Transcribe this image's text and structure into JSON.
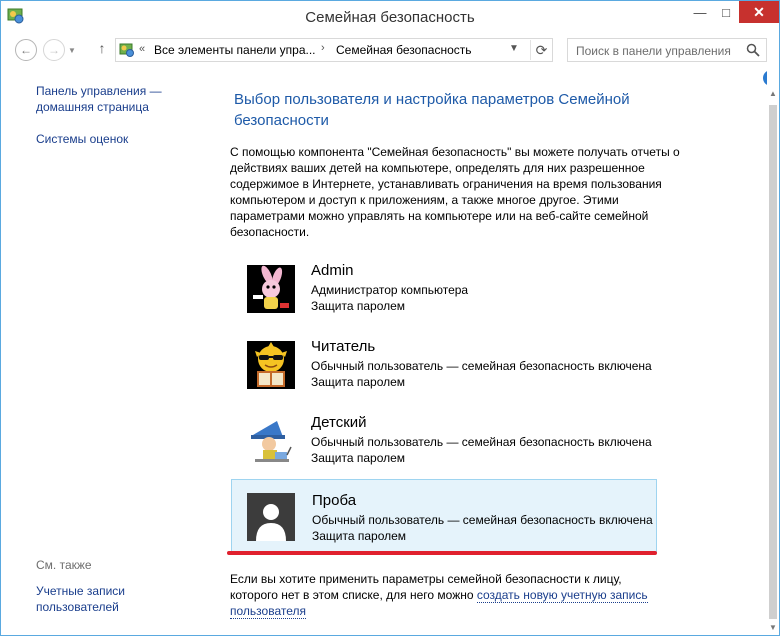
{
  "window": {
    "title": "Семейная безопасность",
    "controls": {
      "minimize": "—",
      "maximize": "□",
      "close": "✕"
    }
  },
  "nav": {
    "back_icon": "arrow-left-icon",
    "forward_icon": "arrow-right-icon",
    "up_icon": "arrow-up-icon"
  },
  "address": {
    "chevron": "«",
    "segments": [
      "Все элементы панели упра...",
      "Семейная безопасность"
    ],
    "separator": "›"
  },
  "search": {
    "placeholder": "Поиск в панели управления"
  },
  "sidebar": {
    "home_link": "Панель управления — домашняя страница",
    "ratings_link": "Системы оценок",
    "see_also": "См. также",
    "accounts_link": "Учетные записи пользователей"
  },
  "main": {
    "title": "Выбор пользователя и настройка параметров Семейной безопасности",
    "description": "С помощью компонента \"Семейная безопасность\" вы можете получать отчеты о действиях ваших детей на компьютере, определять для них разрешенное содержимое в Интернете, устанавливать ограничения на время пользования компьютером и доступ к приложениям, а также многое другое. Этими параметрами можно управлять на компьютере или на веб-сайте семейной безопасности.",
    "users": [
      {
        "name": "Admin",
        "role": "Администратор компьютера",
        "password": "Защита паролем"
      },
      {
        "name": "Читатель",
        "role": "Обычный пользователь — семейная безопасность включена",
        "password": "Защита паролем"
      },
      {
        "name": "Детский",
        "role": "Обычный пользователь — семейная безопасность включена",
        "password": "Защита паролем"
      },
      {
        "name": "Проба",
        "role": "Обычный пользователь — семейная безопасность включена",
        "password": "Защита паролем"
      }
    ],
    "bottom_text": "Если вы хотите применить параметры семейной безопасности к лицу, которого нет в этом списке, для него можно ",
    "bottom_link": "создать новую учетную запись пользователя"
  },
  "colors": {
    "title_blue": "#1e5aa8",
    "link_blue": "#1a3e8c",
    "close_red": "#c7312e",
    "selected_bg": "#e5f3fb",
    "annotation_red": "#e0202e"
  }
}
